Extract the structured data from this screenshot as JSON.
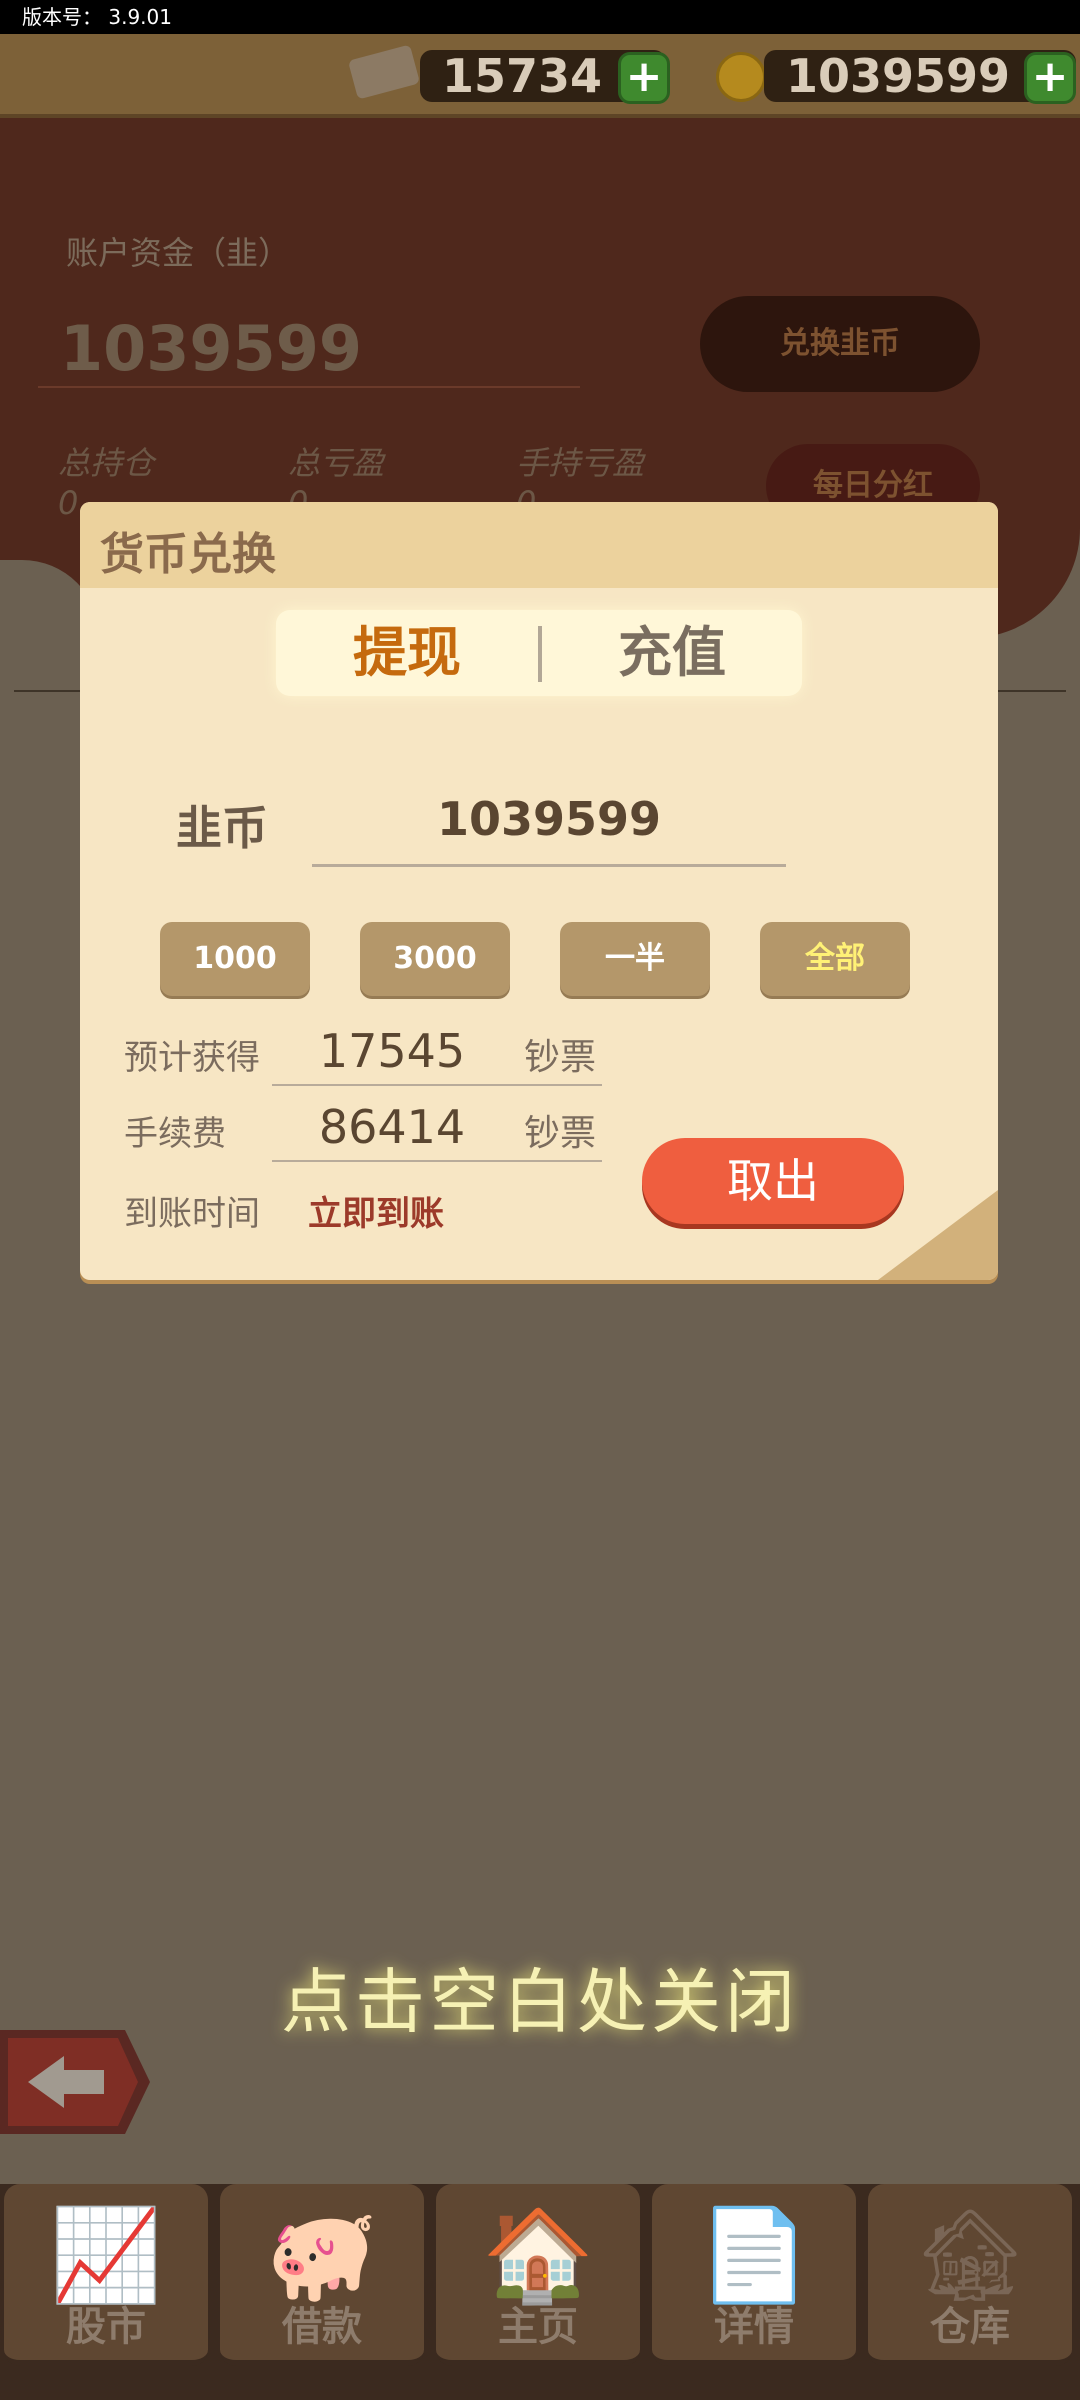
{
  "status": {
    "version_text": "版本号： 3.9.01"
  },
  "topbar": {
    "banknotes": "15734",
    "coins": "1039599",
    "plus": "+"
  },
  "account": {
    "funds_label": "账户资金（韭）",
    "funds_value": "1039599",
    "exchange_button": "兑换韭币",
    "total_holdings_label": "总持仓",
    "total_pnl_label": "总亏盈",
    "holding_pnl_label": "手持亏盈",
    "daily_dividend_button": "每日分红",
    "total_holdings_value": "0",
    "total_pnl_value": "0",
    "holding_pnl_value": "0"
  },
  "modal": {
    "title": "货币兑换",
    "tabs": [
      {
        "label": "提现"
      },
      {
        "label": "充值"
      }
    ],
    "currency_label": "韭币",
    "amount": "1039599",
    "quick_buttons": [
      {
        "label": "1000"
      },
      {
        "label": "3000"
      },
      {
        "label": "一半"
      },
      {
        "label": "全部"
      }
    ],
    "expected_label": "预计获得",
    "expected_value": "17545",
    "expected_unit": "钞票",
    "fee_label": "手续费",
    "fee_value": "86414",
    "fee_unit": "钞票",
    "arrival_label": "到账时间",
    "arrival_value": "立即到账",
    "withdraw_button": "取出"
  },
  "close_hint": "点击空白处关闭",
  "nav": {
    "items": [
      {
        "label": "股市",
        "icon": "stock-chart-icon",
        "glyph": "📈"
      },
      {
        "label": "借款",
        "icon": "piggy-bank-icon",
        "glyph": "🐖"
      },
      {
        "label": "主页",
        "icon": "home-icon",
        "glyph": "🏠"
      },
      {
        "label": "详情",
        "icon": "document-icon",
        "glyph": "📄"
      },
      {
        "label": "仓库",
        "icon": "warehouse-icon",
        "glyph": "🏚"
      }
    ]
  },
  "colors": {
    "accent": "#c56a0e",
    "withdraw": "#ef5e3f",
    "overlay": "#6b6051"
  }
}
